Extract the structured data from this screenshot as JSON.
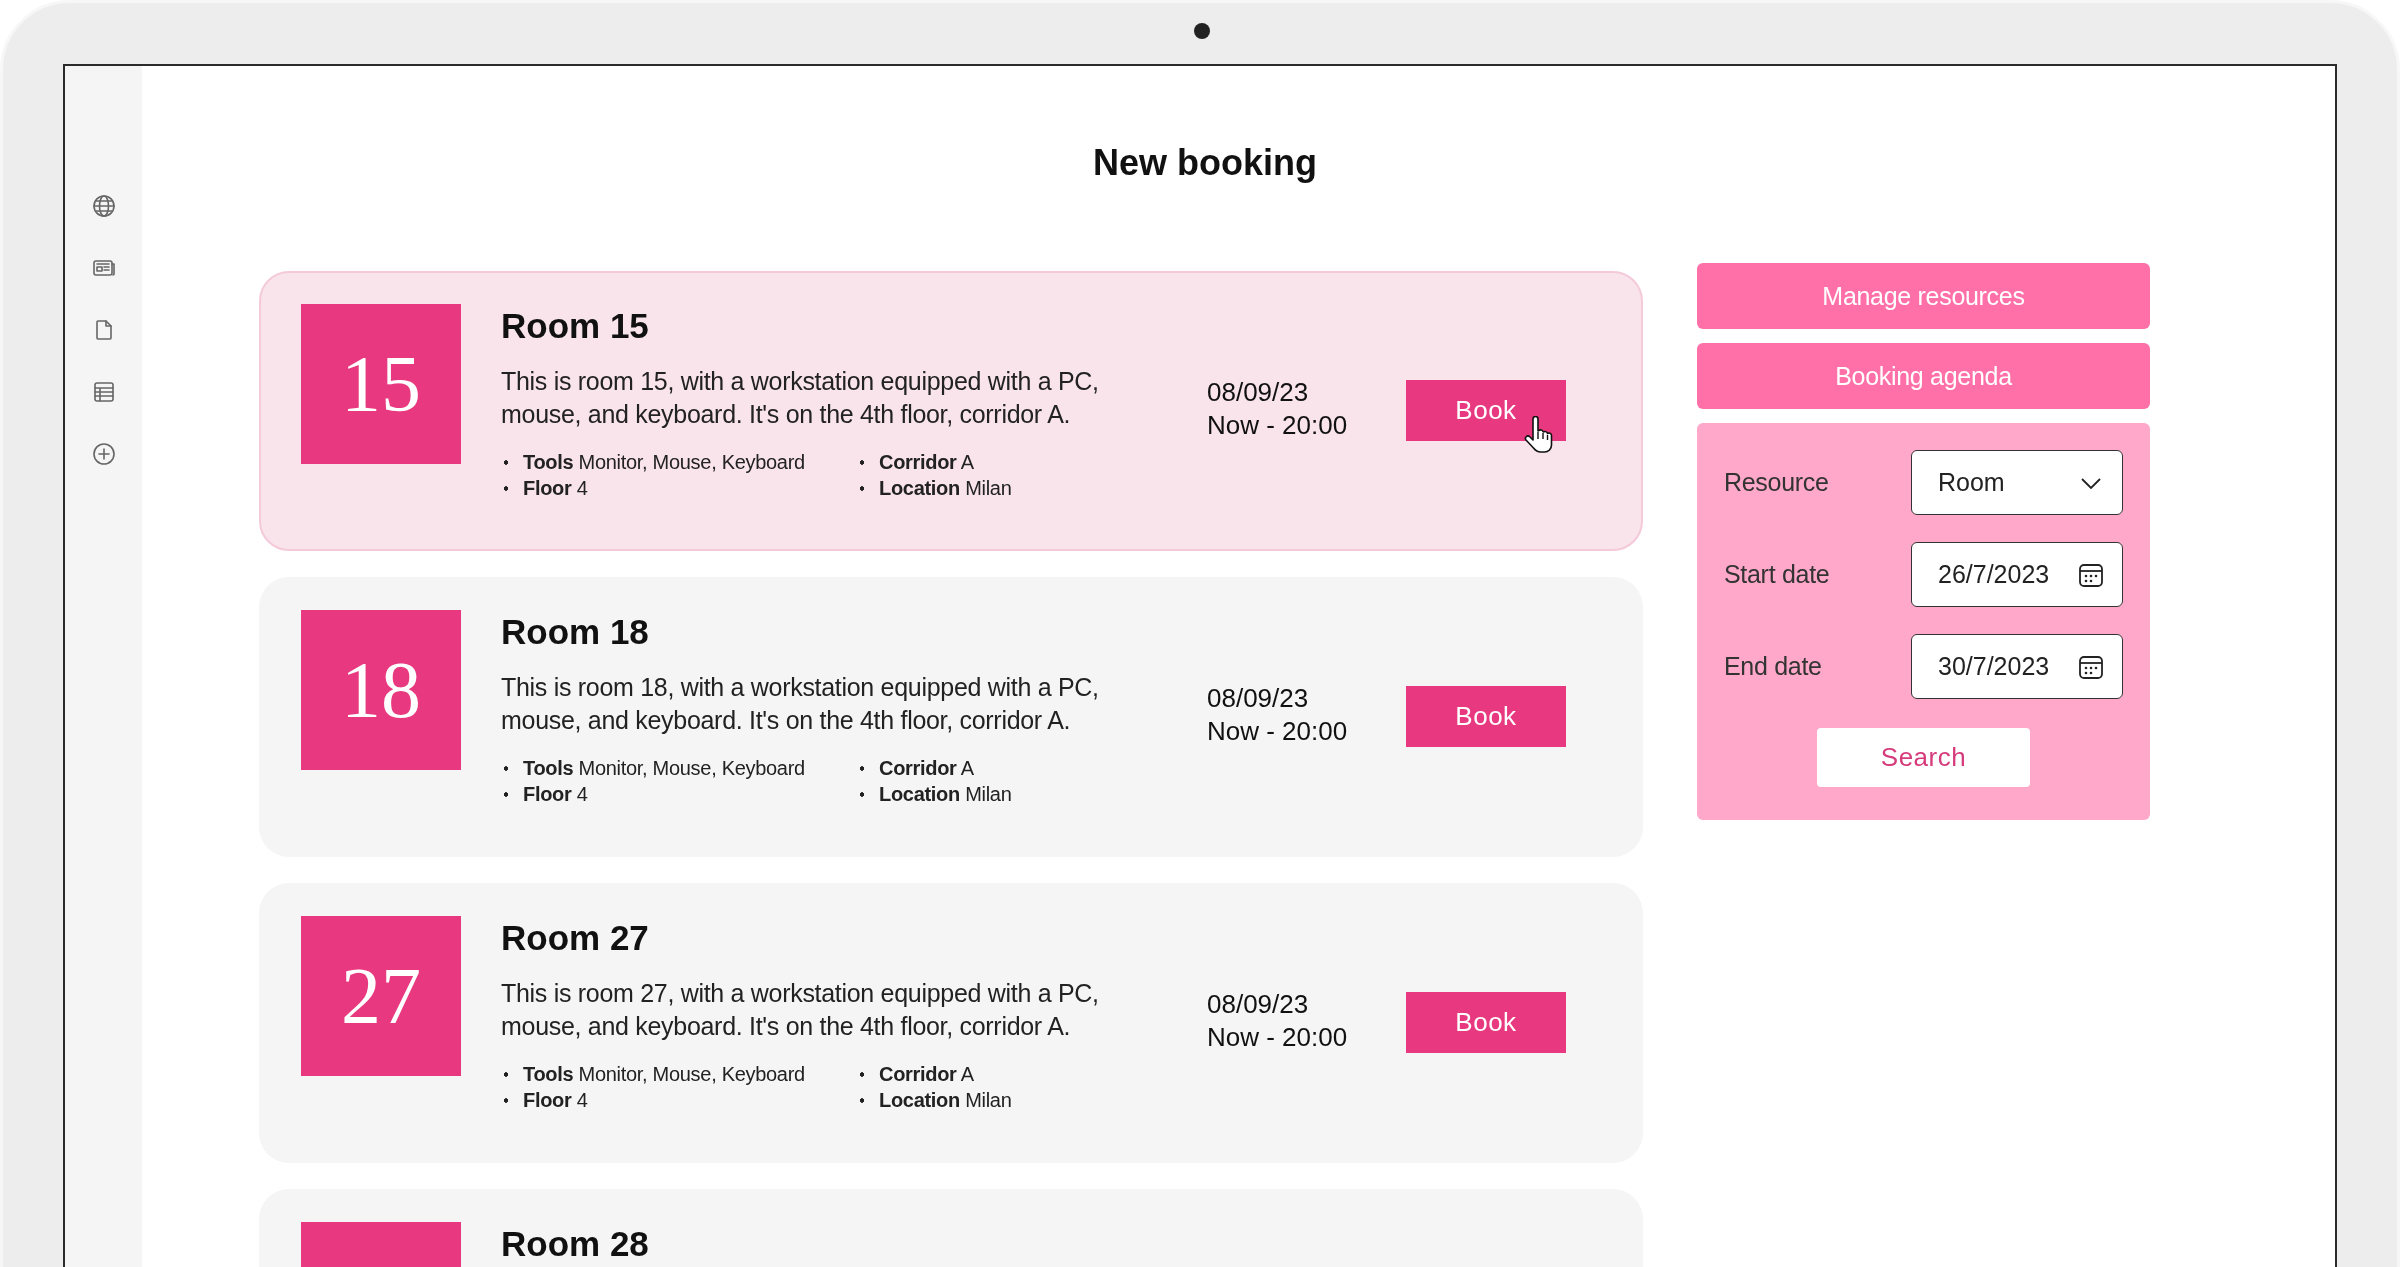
{
  "title": "New booking",
  "rooms": [
    {
      "number": "15",
      "title": "Room 15",
      "description": "This is room 15, with a workstation equipped with a PC, mouse, and keyboard. It's on the 4th floor, corridor A.",
      "details": [
        "**Tools** Monitor, Mouse, Keyboard",
        "**Corridor** A",
        "**Floor** 4",
        "**Location** Milan"
      ],
      "date": "08/09/23",
      "time": "Now - 20:00",
      "button": "Book",
      "selected": true,
      "pointer": true
    },
    {
      "number": "18",
      "title": "Room 18",
      "description": "This is room 18, with a workstation equipped with a PC, mouse, and keyboard. It's on the 4th floor, corridor A.",
      "details": [
        "**Tools** Monitor, Mouse, Keyboard",
        "**Corridor** A",
        "**Floor** 4",
        "**Location** Milan"
      ],
      "date": "08/09/23",
      "time": "Now - 20:00",
      "button": "Book",
      "selected": false,
      "pointer": false
    },
    {
      "number": "27",
      "title": "Room 27",
      "description": "This is room 27, with a workstation equipped with a PC, mouse, and keyboard. It's on the 4th floor, corridor A.",
      "details": [
        "**Tools** Monitor, Mouse, Keyboard",
        "**Corridor** A",
        "**Floor** 4",
        "**Location** Milan"
      ],
      "date": "08/09/23",
      "time": "Now - 20:00",
      "button": "Book",
      "selected": false,
      "pointer": false
    },
    {
      "title": "Room 28",
      "selected": false
    }
  ],
  "actions": [
    "Manage resources",
    "Booking agenda"
  ],
  "filters": [
    {
      "kind": "select",
      "label": "Resource",
      "value": "Room"
    },
    {
      "kind": "date",
      "label": "Start date",
      "value": "26/7/2023"
    },
    {
      "kind": "date",
      "label": "End date",
      "value": "30/7/2023"
    }
  ],
  "search_button": "Search"
}
